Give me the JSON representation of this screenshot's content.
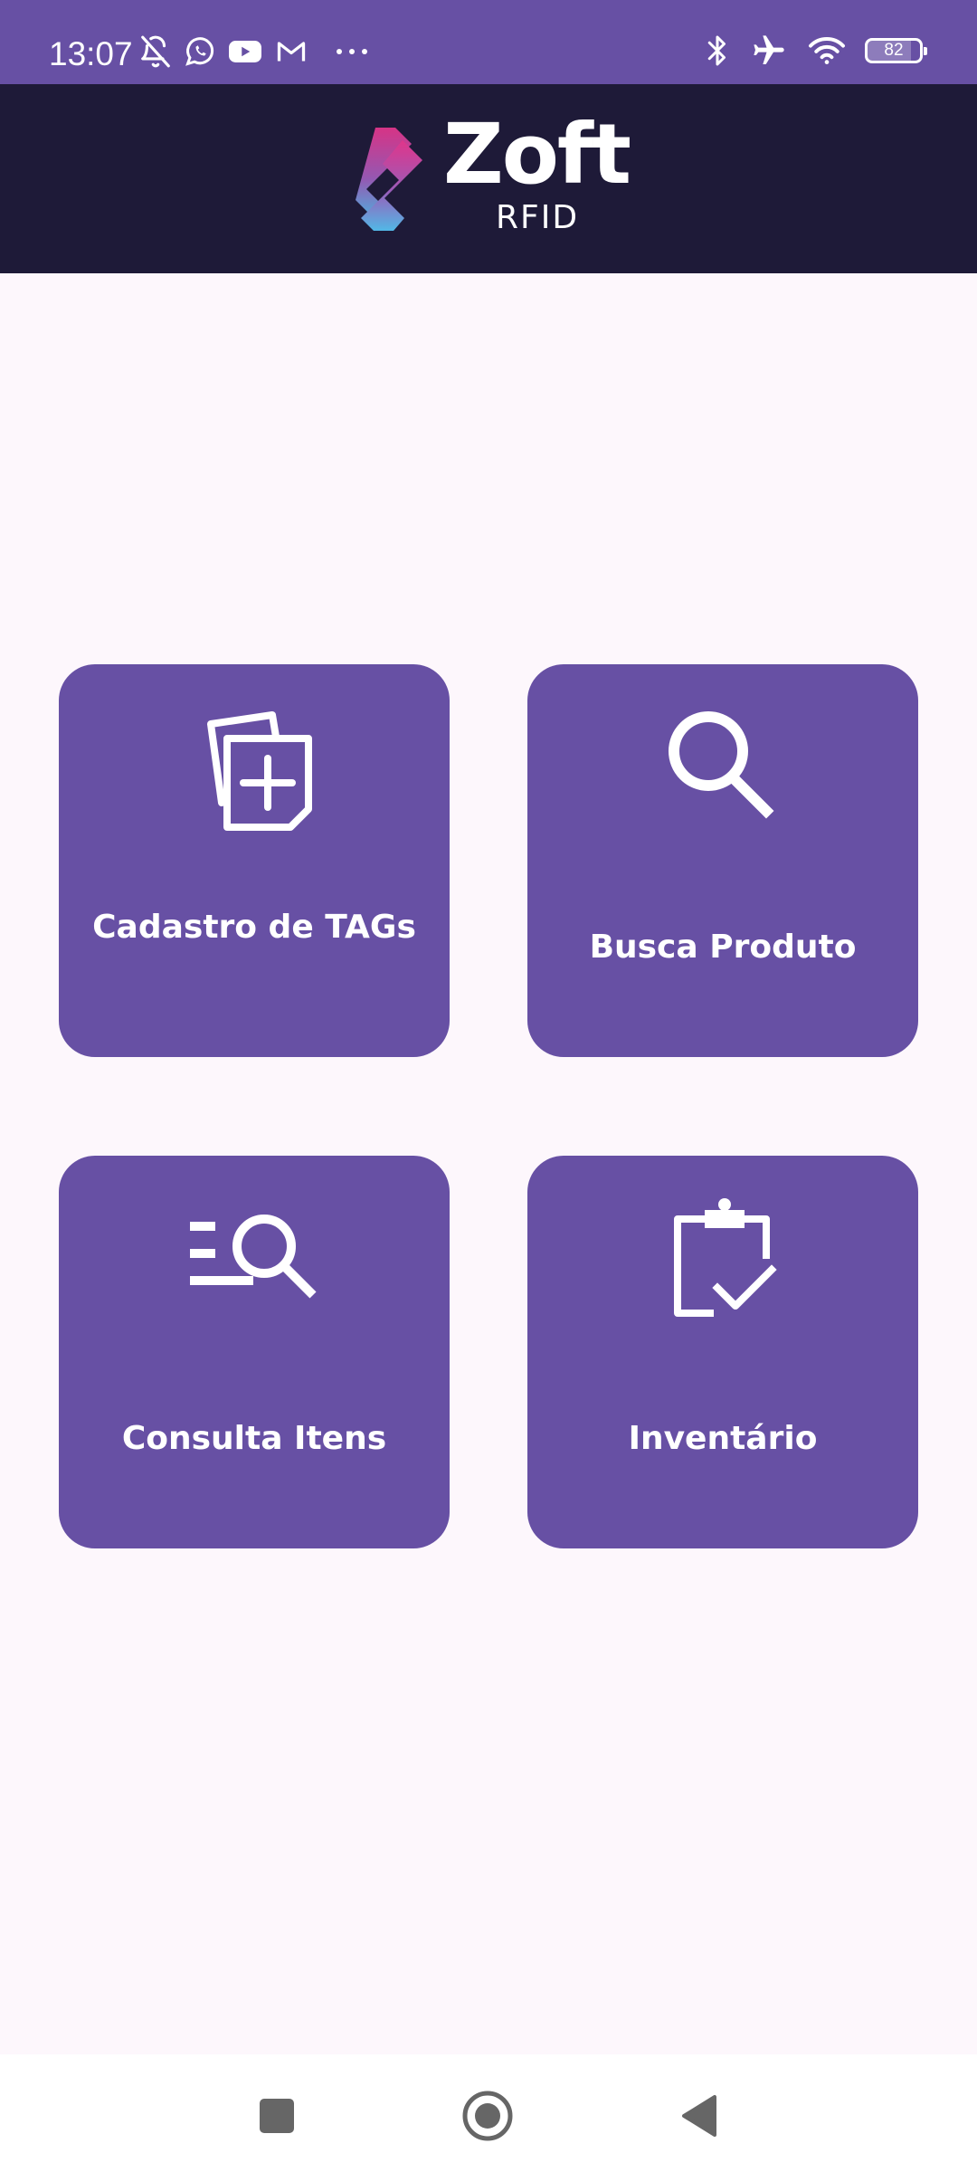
{
  "status_bar": {
    "time": "13:07",
    "battery_level": "82",
    "left_icons": [
      "bell-off-icon",
      "whatsapp-icon",
      "youtube-icon",
      "gmail-icon",
      "more-dots-icon"
    ],
    "right_icons": [
      "bluetooth-icon",
      "airplane-icon",
      "wifi-icon",
      "battery-icon"
    ]
  },
  "header": {
    "logo_word": "Zoft",
    "logo_subtitle": "RFID"
  },
  "menu": {
    "tiles": [
      {
        "label": "Cadastro de TAGs",
        "icon": "add-document-icon"
      },
      {
        "label": "Busca Produto",
        "icon": "search-icon"
      },
      {
        "label": "Consulta Itens",
        "icon": "list-search-icon"
      },
      {
        "label": "Inventário",
        "icon": "clipboard-check-icon"
      }
    ]
  },
  "nav_bar": {
    "buttons": [
      "recent-apps",
      "home",
      "back"
    ]
  },
  "colors": {
    "primary": "#6750a4",
    "header_bg": "#1e1a38",
    "page_bg": "#fdf7fc",
    "on_primary": "#ffffff"
  }
}
